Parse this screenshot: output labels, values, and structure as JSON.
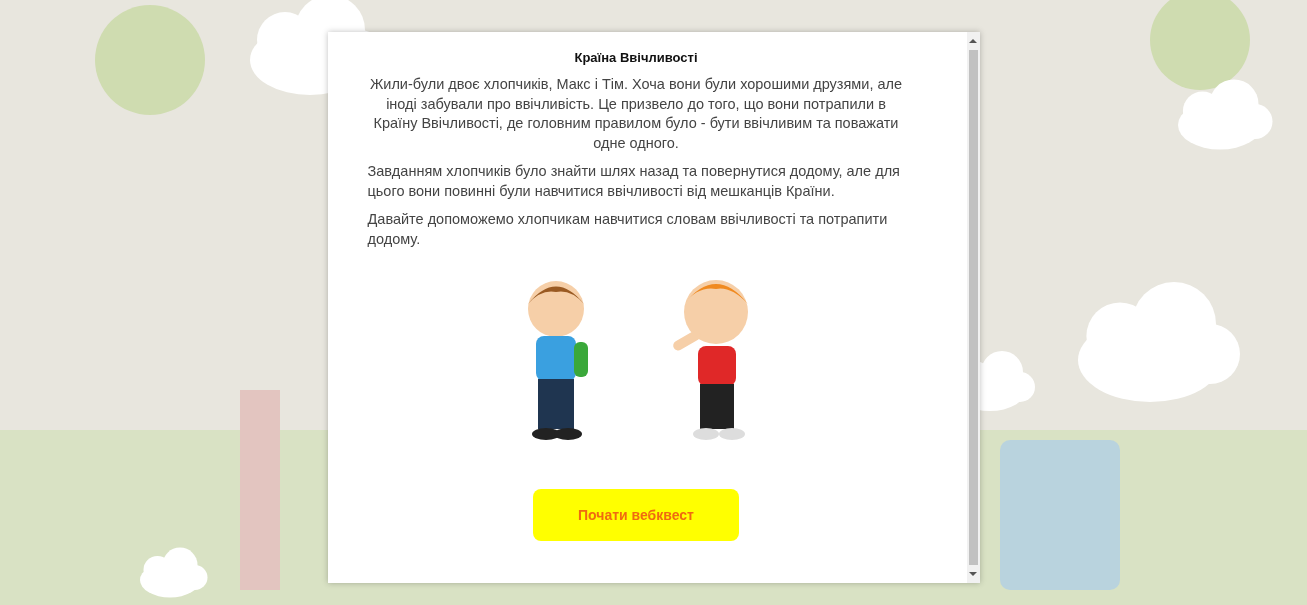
{
  "dialog": {
    "title": "Країна Ввічливості",
    "paragraphs": [
      {
        "text": "Жили-були двоє хлопчиків, Макс і Тім. Хоча вони були хорошими друзями, але іноді забували про ввічливість. Це призвело до того, що вони потрапили в Країну Ввічливості, де головним правилом було - бути ввічливим та поважати одне одного.",
        "kind": "lead"
      },
      {
        "text": "Завданням хлопчиків було знайти шлях назад та повернутися додому, але для цього вони повинні були навчитися ввічливості від мешканців Країни.",
        "kind": "body"
      },
      {
        "text": "Давайте допоможемо хлопчикам навчитися словам ввічливості та потрапити додому.",
        "kind": "body"
      }
    ],
    "button": "Почати вебквест"
  }
}
